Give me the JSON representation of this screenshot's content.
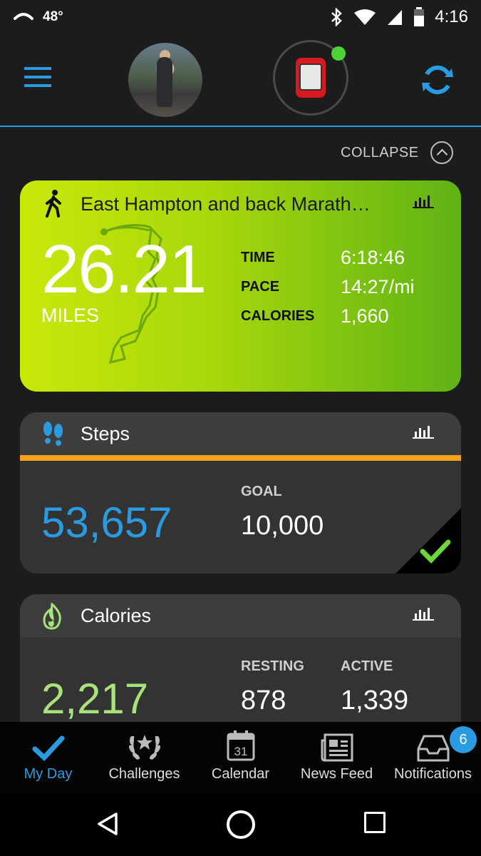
{
  "status_bar": {
    "temperature": "48°",
    "time": "4:16",
    "battery_level": 0.6
  },
  "collapse": {
    "label": "COLLAPSE"
  },
  "activity": {
    "title": "East Hampton and back Marath…",
    "distance": "26.21",
    "unit": "MILES",
    "stats": [
      {
        "label": "TIME",
        "value": "6:18:46"
      },
      {
        "label": "PACE",
        "value": "14:27/mi"
      },
      {
        "label": "CALORIES",
        "value": "1,660"
      }
    ]
  },
  "steps": {
    "title": "Steps",
    "value": "53,657",
    "goal_label": "GOAL",
    "goal_value": "10,000"
  },
  "calories": {
    "title": "Calories",
    "value": "2,217",
    "resting_label": "RESTING",
    "resting_value": "878",
    "active_label": "ACTIVE",
    "active_value": "1,339"
  },
  "tabs": [
    {
      "label": "My Day",
      "icon": "checkmark-icon",
      "active": true
    },
    {
      "label": "Challenges",
      "icon": "laurel-icon"
    },
    {
      "label": "Calendar",
      "icon": "calendar-icon",
      "icon_text": "31"
    },
    {
      "label": "News Feed",
      "icon": "newspaper-icon"
    },
    {
      "label": "Notifications",
      "icon": "inbox-icon",
      "badge": "6"
    }
  ],
  "colors": {
    "accent": "#2a9be0",
    "steps_bar": "#f4a21a",
    "calories_value": "#a8e27a",
    "goal_check": "#6cd63a",
    "device_online": "#4cd137"
  }
}
